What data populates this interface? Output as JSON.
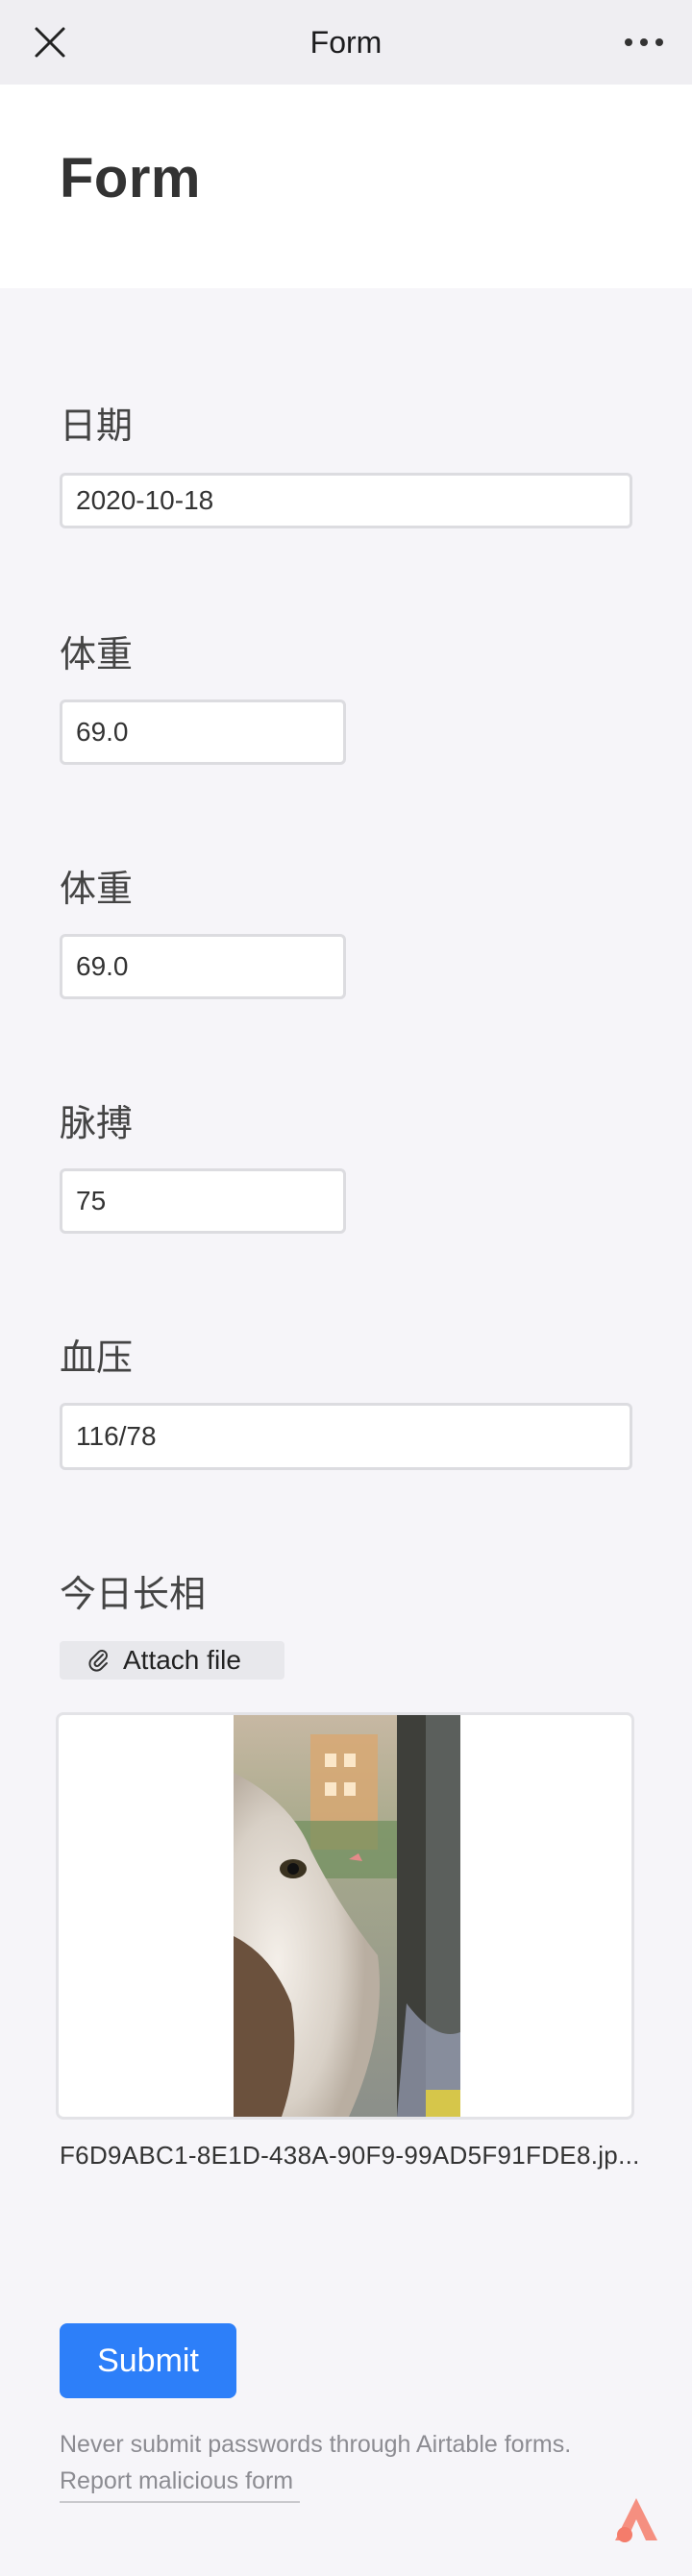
{
  "nav": {
    "title": "Form"
  },
  "form": {
    "title": "Form"
  },
  "fields": {
    "date": {
      "label": "日期",
      "value": "2020-10-18"
    },
    "weight1": {
      "label": "体重",
      "value": "69.0"
    },
    "weight2": {
      "label": "体重",
      "value": "69.0"
    },
    "pulse": {
      "label": "脉搏",
      "value": "75"
    },
    "blood_pressure": {
      "label": "血压",
      "value": "116/78"
    },
    "photo": {
      "label": "今日长相",
      "attach_label": "Attach file",
      "file_name": "F6D9ABC1-8E1D-438A-90F9-99AD5F91FDE8.jp..."
    }
  },
  "submit_label": "Submit",
  "footer": {
    "warning": "Never submit passwords through Airtable forms.",
    "report_link": "Report malicious form"
  },
  "colors": {
    "accent": "#2d7ff9",
    "brand": "#f47c6b",
    "background": "#f6f5f9"
  }
}
